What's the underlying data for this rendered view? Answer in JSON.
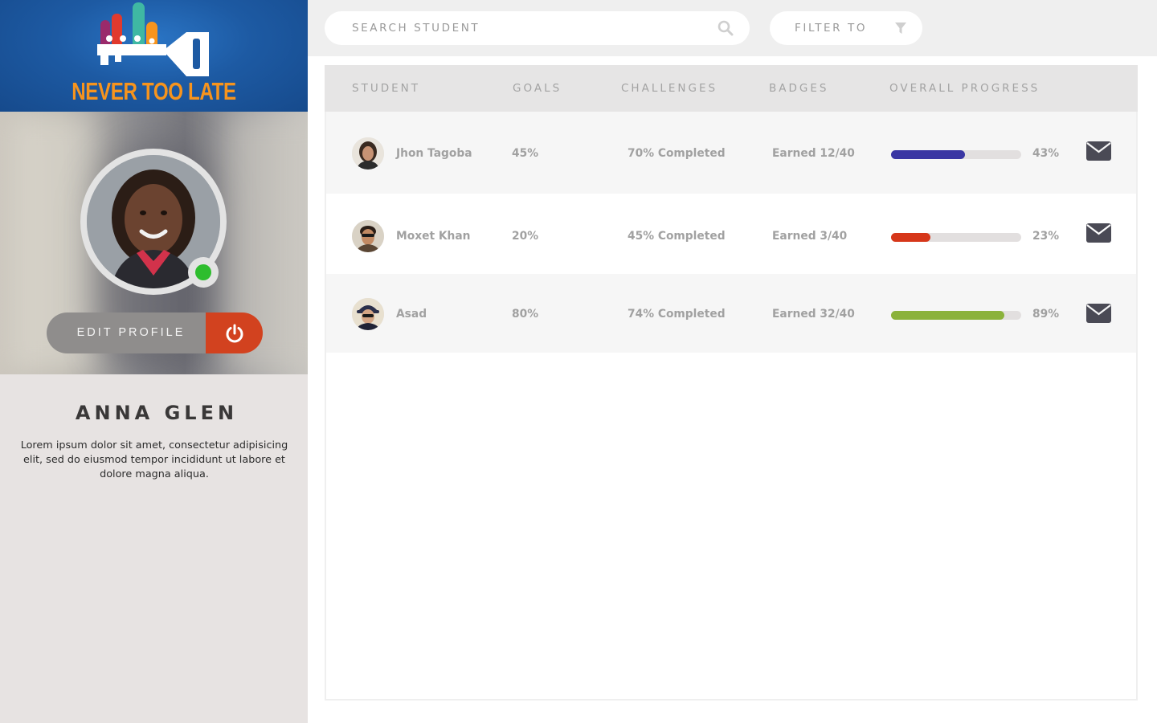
{
  "brand": {
    "name": "NEVER TOO LATE"
  },
  "profile": {
    "name": "ANNA GLEN",
    "bio": "Lorem ipsum dolor sit amet, consectetur adipisicing elit, sed do eiusmod tempor incididunt ut labore et dolore magna aliqua.",
    "status": "online",
    "edit_label": "EDIT PROFILE"
  },
  "search": {
    "placeholder": "SEARCH STUDENT",
    "value": ""
  },
  "filter": {
    "label": "FILTER TO"
  },
  "table": {
    "headers": [
      "STUDENT",
      "GOALS",
      "CHALLENGES",
      "BADGES",
      "OVERALL PROGRESS"
    ],
    "rows": [
      {
        "name": "Jhon Tagoba",
        "goals": "45%",
        "challenges": "70% Completed",
        "badges": "Earned 12/40",
        "progress": 57,
        "progress_label": "43%",
        "color": "#3a36a3"
      },
      {
        "name": "Moxet Khan",
        "goals": "20%",
        "challenges": "45% Completed",
        "badges": "Earned 3/40",
        "progress": 30,
        "progress_label": "23%",
        "color": "#d6371a"
      },
      {
        "name": "Asad",
        "goals": "80%",
        "challenges": "74% Completed",
        "badges": "Earned 32/40",
        "progress": 87,
        "progress_label": "89%",
        "color": "#8bb23b"
      }
    ]
  },
  "colors": {
    "brand_blue": "#1d5aa3",
    "brand_orange": "#f7941d",
    "power_red": "#d2421f",
    "online_green": "#2ebd2e"
  }
}
